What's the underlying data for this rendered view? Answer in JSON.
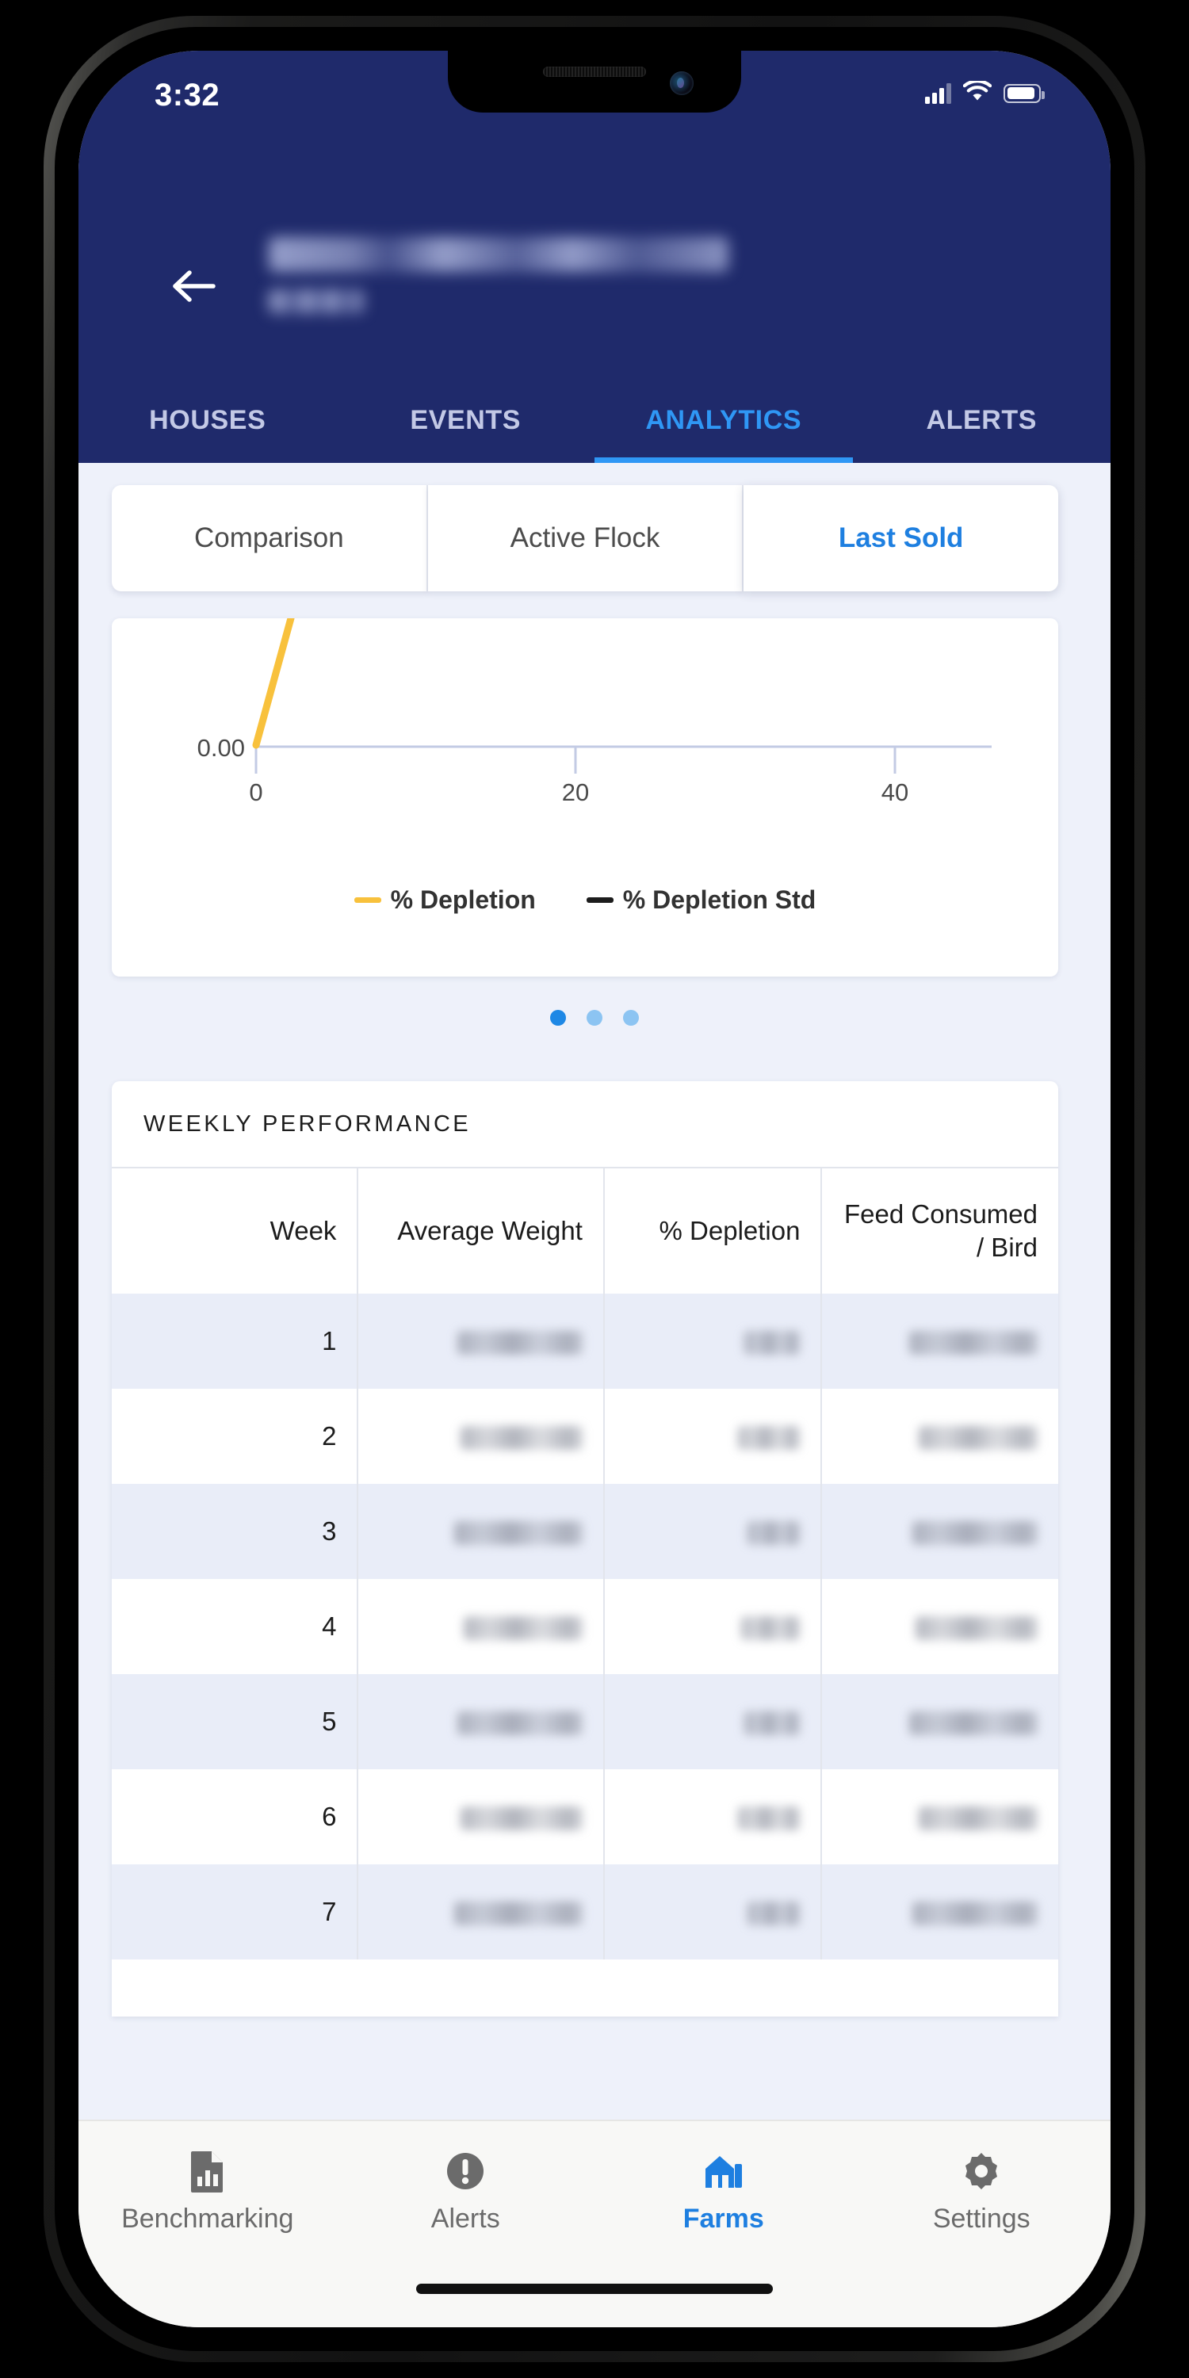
{
  "status_bar": {
    "time": "3:32",
    "signal_icon": "cellular-signal-icon",
    "wifi_icon": "wifi-icon",
    "battery_icon": "battery-icon"
  },
  "header": {
    "back_icon": "back-arrow-icon",
    "title_redacted": true,
    "background_color": "#1f2a6b"
  },
  "top_tabs": {
    "items": [
      {
        "label": "HOUSES",
        "active": false
      },
      {
        "label": "EVENTS",
        "active": false
      },
      {
        "label": "ANALYTICS",
        "active": true
      },
      {
        "label": "ALERTS",
        "active": false
      }
    ],
    "active_color": "#2f97f5",
    "inactive_color": "#c3c9e6"
  },
  "segmented_control": {
    "options": [
      {
        "label": "Comparison",
        "active": false
      },
      {
        "label": "Active Flock",
        "active": false
      },
      {
        "label": "Last Sold",
        "active": true
      }
    ],
    "active_color": "#1e7fe0"
  },
  "chart_data": {
    "type": "line",
    "title": "",
    "xlabel": "",
    "ylabel": "",
    "xlim": [
      0,
      49
    ],
    "ylim": [
      0,
      1
    ],
    "x_ticks": [
      "0",
      "20",
      "40"
    ],
    "y_ticks": [
      "0.00"
    ],
    "grid": false,
    "legend_position": "bottom",
    "series": [
      {
        "name": "% Depletion",
        "color": "#f8c13c",
        "x": [
          0,
          2
        ],
        "values": [
          0.0,
          1.0
        ]
      },
      {
        "name": "% Depletion Std",
        "color": "#1c1c1c",
        "x": [],
        "values": []
      }
    ],
    "note": "Chart is scrolled; only the lower portion of the plot area is visible."
  },
  "carousel": {
    "total_dots": 3,
    "active_index": 0,
    "active_color": "#1e88e5",
    "inactive_color": "#8cc4f2"
  },
  "table": {
    "title": "WEEKLY PERFORMANCE",
    "columns": [
      "Week",
      "Average Weight",
      "% Depletion",
      "Feed Consumed / Bird"
    ],
    "rows": [
      {
        "week": "1",
        "average_weight": "",
        "depletion": "",
        "feed_consumed": ""
      },
      {
        "week": "2",
        "average_weight": "",
        "depletion": "",
        "feed_consumed": ""
      },
      {
        "week": "3",
        "average_weight": "",
        "depletion": "",
        "feed_consumed": ""
      },
      {
        "week": "4",
        "average_weight": "",
        "depletion": "",
        "feed_consumed": ""
      },
      {
        "week": "5",
        "average_weight": "",
        "depletion": "",
        "feed_consumed": ""
      },
      {
        "week": "6",
        "average_weight": "",
        "depletion": "",
        "feed_consumed": ""
      },
      {
        "week": "7",
        "average_weight": "",
        "depletion": "",
        "feed_consumed": ""
      }
    ],
    "values_redacted": true
  },
  "bottom_nav": {
    "items": [
      {
        "label": "Benchmarking",
        "icon": "document-chart-icon",
        "active": false
      },
      {
        "label": "Alerts",
        "icon": "exclamation-circle-icon",
        "active": false
      },
      {
        "label": "Farms",
        "icon": "barn-icon",
        "active": true
      },
      {
        "label": "Settings",
        "icon": "gear-icon",
        "active": false
      }
    ],
    "active_color": "#1e7fe0",
    "inactive_color": "#6b6b6b"
  }
}
